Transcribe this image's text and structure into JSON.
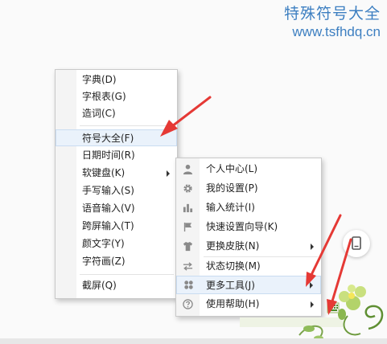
{
  "watermark": {
    "title": "特殊符号大全",
    "url": "www.tsfhdq.cn"
  },
  "main_menu": {
    "items": [
      {
        "label": "字典(D)"
      },
      {
        "label": "字根表(G)"
      },
      {
        "label": "造词(C)"
      },
      {
        "label": "符号大全(F)"
      },
      {
        "label": "日期时间(R)"
      },
      {
        "label": "软键盘(K)"
      },
      {
        "label": "手写输入(S)"
      },
      {
        "label": "语音输入(V)"
      },
      {
        "label": "跨屏输入(T)"
      },
      {
        "label": "颜文字(Y)"
      },
      {
        "label": "字符画(Z)"
      },
      {
        "label": "截屏(Q)"
      }
    ]
  },
  "settings_menu": {
    "items": [
      {
        "label": "个人中心(L)",
        "icon": "person-icon"
      },
      {
        "label": "我的设置(P)",
        "icon": "gear-icon"
      },
      {
        "label": "输入统计(I)",
        "icon": "bar-chart-icon"
      },
      {
        "label": "快速设置向导(K)",
        "icon": "flag-icon"
      },
      {
        "label": "更换皮肤(N)",
        "icon": "shirt-icon"
      },
      {
        "label": "状态切换(M)",
        "icon": "switch-arrows-icon"
      },
      {
        "label": "更多工具(J)",
        "icon": "tools-icon"
      },
      {
        "label": "使用帮助(H)",
        "icon": "help-icon"
      }
    ]
  },
  "colors": {
    "highlight": "#eaf2fb",
    "arrow": "#e53935",
    "watermark": "#3d7fc1"
  }
}
